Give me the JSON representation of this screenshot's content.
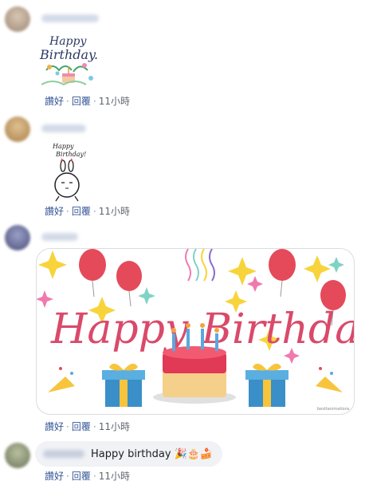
{
  "comments": [
    {
      "actions": {
        "like": "讚好",
        "reply": "回覆",
        "time": "11小時"
      }
    },
    {
      "sticker_text": "Happy Birthday!",
      "actions": {
        "like": "讚好",
        "reply": "回覆",
        "time": "11小時"
      }
    },
    {
      "card_text": "Happy Birthday",
      "watermark": "besttanimations",
      "actions": {
        "like": "讚好",
        "reply": "回覆",
        "time": "11小時"
      }
    },
    {
      "text": "Happy birthday",
      "emoji": "🎉🎂🍰",
      "actions": {
        "like": "讚好",
        "reply": "回覆",
        "time": "11小時"
      }
    }
  ],
  "colors": {
    "link": "#385898",
    "meta": "#606770",
    "bubble": "#f0f2f5",
    "card_pink": "#d94a6a"
  }
}
